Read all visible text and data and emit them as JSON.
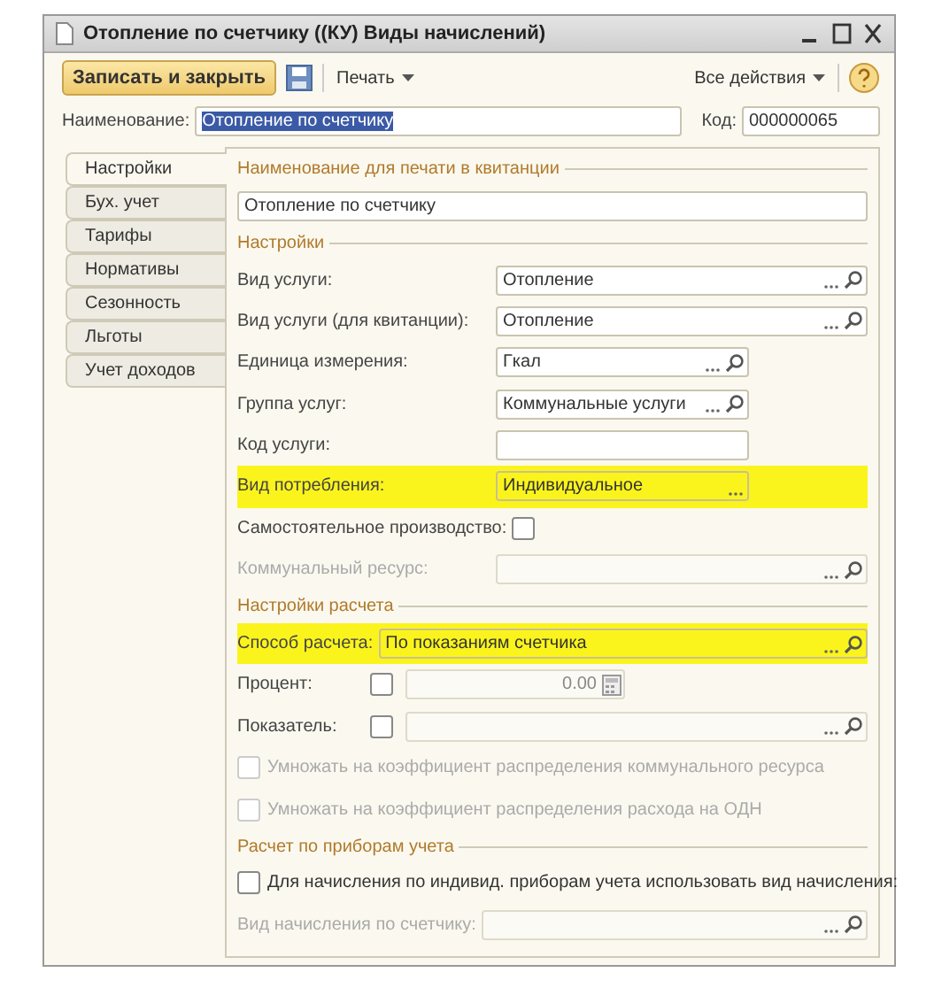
{
  "window": {
    "title": "Отопление по счетчику ((КУ) Виды начислений)"
  },
  "toolbar": {
    "save_close": "Записать и закрыть",
    "print": "Печать",
    "all_actions": "Все действия"
  },
  "name_field": {
    "label": "Наименование:",
    "value": "Отопление по счетчику",
    "selected": true
  },
  "code_field": {
    "label": "Код:",
    "value": "000000065"
  },
  "tabs": [
    {
      "label": "Настройки",
      "selected": true
    },
    {
      "label": "Бух. учет",
      "selected": false
    },
    {
      "label": "Тарифы",
      "selected": false
    },
    {
      "label": "Нормативы",
      "selected": false
    },
    {
      "label": "Сезонность",
      "selected": false
    },
    {
      "label": "Льготы",
      "selected": false
    },
    {
      "label": "Учет доходов",
      "selected": false
    }
  ],
  "sections": [
    {
      "title": "Наименование  для печати в квитанции",
      "rows": [
        {
          "kind": "text",
          "value": "Отопление по счетчику"
        }
      ]
    },
    {
      "title": "Настройки",
      "rows": [
        {
          "kind": "select",
          "label": "Вид услуги:",
          "value": "Отопление",
          "disabled": false
        },
        {
          "kind": "select",
          "label": "Вид услуги (для квитанции):",
          "value": "Отопление",
          "disabled": false
        },
        {
          "kind": "short_select",
          "label": "Единица измерения:",
          "value": "Гкал",
          "disabled": false
        },
        {
          "kind": "short_select",
          "label": "Группа услуг:",
          "value": "Коммунальные услуги",
          "disabled": false
        },
        {
          "kind": "short_text",
          "label": "Код услуги:",
          "disabled": false
        },
        {
          "kind": "short_choice",
          "label": "Вид потребления:",
          "value": "Индивидуальное",
          "highlighted": true,
          "disabled": false
        },
        {
          "kind": "label_check",
          "label": "Самостоятельное производство:",
          "checked": false
        },
        {
          "kind": "select",
          "label": "Коммунальный ресурс:",
          "disabled": true
        }
      ]
    },
    {
      "title": "Настройки расчета",
      "rows": [
        {
          "kind": "inline_select",
          "label": "Способ расчета:",
          "value": "По показаниям счетчика",
          "highlighted": true,
          "disabled": false
        },
        {
          "kind": "check_number",
          "label": "Процент:",
          "checked": false,
          "value": "0.00",
          "disabled": true
        },
        {
          "kind": "check_select",
          "label": "Показатель:",
          "checked": false,
          "disabled": true
        },
        {
          "kind": "checkbox",
          "label": "Умножать на коэффициент распределения коммунального ресурса",
          "checked": false,
          "disabled": true
        },
        {
          "kind": "checkbox",
          "label": "Умножать на коэффициент распределения расхода на ОДН",
          "checked": false,
          "disabled": true
        }
      ]
    },
    {
      "title": "Расчет по приборам учета",
      "rows": [
        {
          "kind": "checkbox",
          "label": "Для начисления по индивид. приборам учета использовать вид начисления:",
          "checked": false,
          "disabled": false
        },
        {
          "kind": "inline_select",
          "label": "Вид начисления по счетчику:",
          "disabled": true
        }
      ]
    }
  ]
}
